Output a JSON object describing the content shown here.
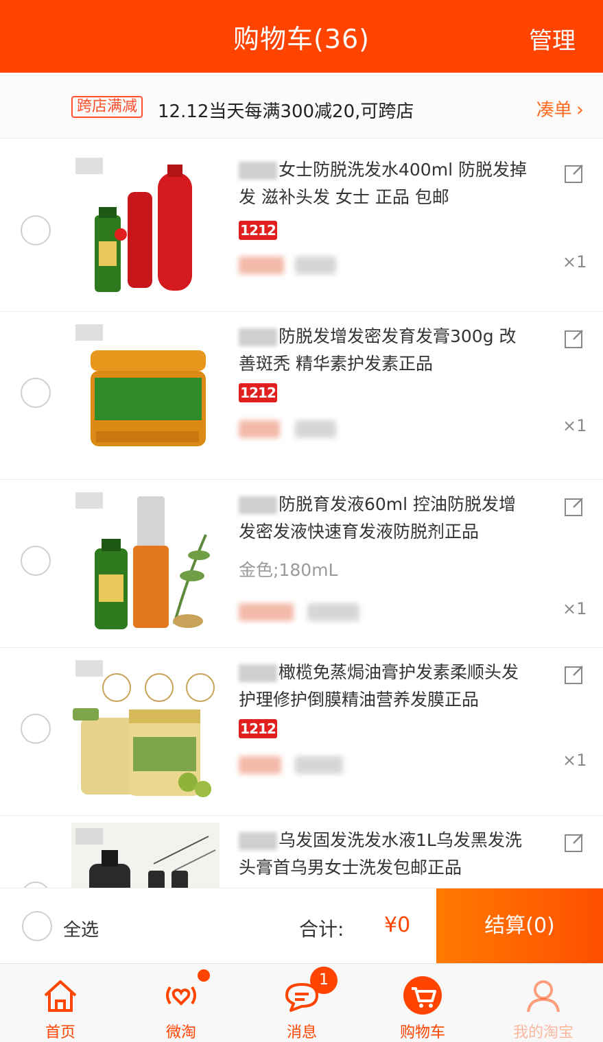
{
  "header": {
    "title": "购物车(36)",
    "manage": "管理"
  },
  "promo": {
    "tag": "跨店满减",
    "text": "12.12当天每满300减20,可跨店",
    "more": "凑单"
  },
  "items": [
    {
      "title": "女士防脱洗发水400ml 防脱发掉发 滋补头发 女士 正品 包邮",
      "badge": "1212",
      "sku": "",
      "qty": "×1"
    },
    {
      "title": "防脱发增发密发育发膏300g 改善斑秃 精华素护发素正品",
      "badge": "1212",
      "sku": "",
      "qty": "×1"
    },
    {
      "title": "防脱育发液60ml 控油防脱发增发密发液快速育发液防脱剂正品",
      "badge": "",
      "sku": "金色;180mL",
      "qty": "×1"
    },
    {
      "title": "橄榄免蒸焗油膏护发素柔顺头发护理修护倒膜精油营养发膜正品",
      "badge": "1212",
      "sku": "",
      "qty": "×1"
    },
    {
      "title": "乌发固发洗发水液1L乌发黑发洗头膏首乌男女士洗发包邮正品",
      "badge": "",
      "sku": "",
      "qty": ""
    }
  ],
  "bottom": {
    "select_all": "全选",
    "total_label": "合计:",
    "total_value": "¥0",
    "checkout": "结算(0)"
  },
  "tabs": [
    {
      "label": "首页",
      "icon": "home-icon"
    },
    {
      "label": "微淘",
      "icon": "weitao-icon",
      "dot": true
    },
    {
      "label": "消息",
      "icon": "message-icon",
      "count": "1"
    },
    {
      "label": "购物车",
      "icon": "cart-icon"
    },
    {
      "label": "我的淘宝",
      "icon": "profile-icon"
    }
  ],
  "colors": {
    "brand": "#ff4400",
    "badge": "#e11f1f",
    "checkout_start": "#ff7a00",
    "checkout_end": "#ff4f00"
  }
}
